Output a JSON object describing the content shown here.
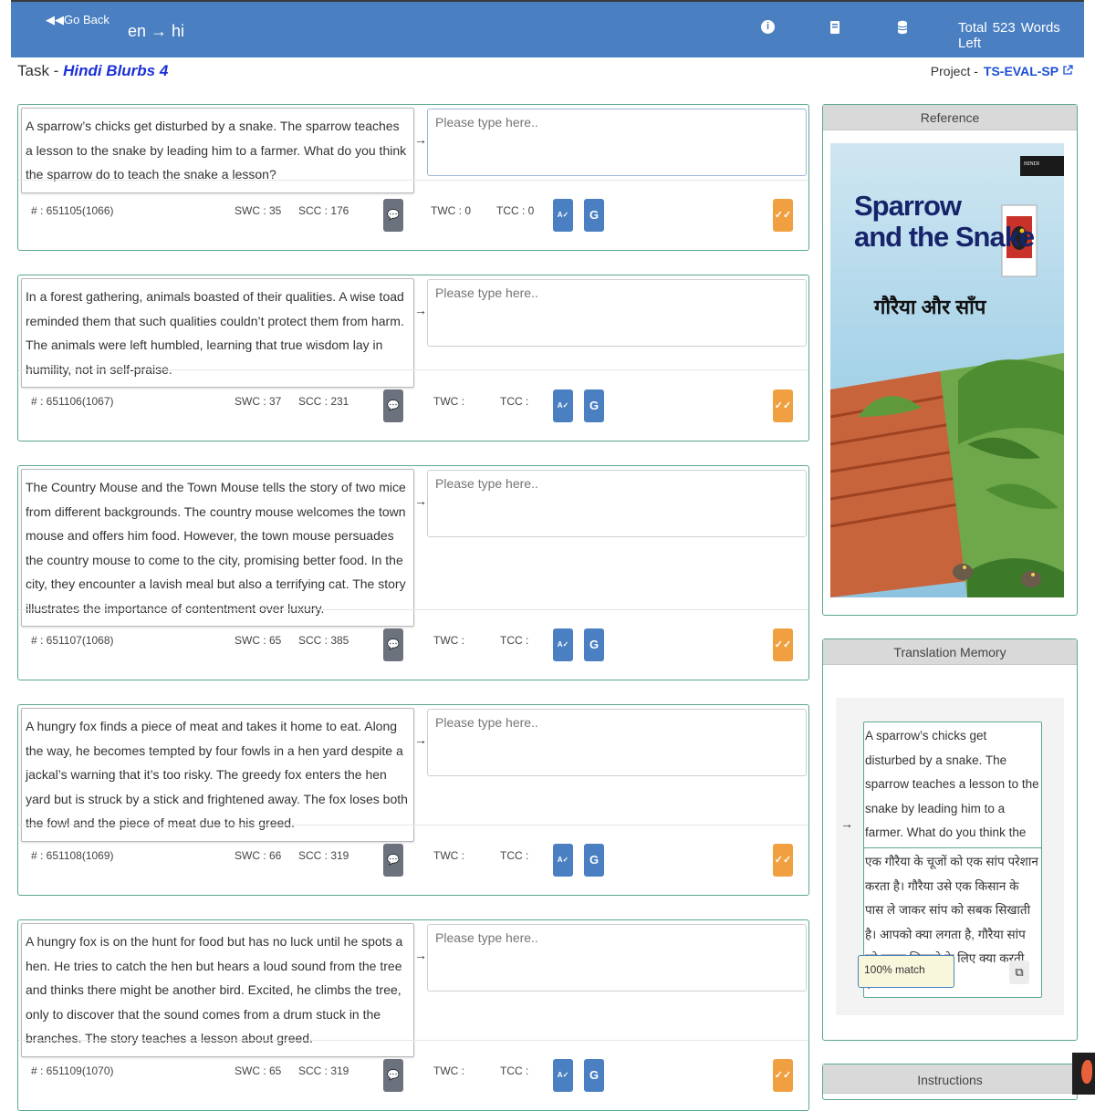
{
  "header": {
    "go_back": "◀◀Go Back",
    "lang_pair": "en → hi",
    "icons": [
      "info-icon",
      "book-icon",
      "database-icon"
    ],
    "words_total_label": "Total",
    "words_count": "523",
    "words_left_label": "Words Left"
  },
  "task": {
    "label": "Task -",
    "name": "Hindi Blurbs 4"
  },
  "project": {
    "label": "Project -",
    "name": "TS-EVAL-SP"
  },
  "target_placeholder": "Please type here..",
  "segments": [
    {
      "source": "A sparrow’s chicks get disturbed by a snake. The sparrow teaches a lesson to the snake by leading him to a farmer. What do you think the sparrow do to teach the snake a lesson?",
      "id": "# : 651105(1066)",
      "swc": "SWC : 35",
      "scc": "SCC : 176",
      "twc": "TWC : 0",
      "tcc": "TCC : 0"
    },
    {
      "source": "In a forest gathering, animals boasted of their qualities. A wise toad reminded them that such qualities couldn’t protect them from harm. The animals were left humbled, learning that true wisdom lay in humility, not in self-praise.",
      "id": "# : 651106(1067)",
      "swc": "SWC : 37",
      "scc": "SCC : 231",
      "twc": "TWC :",
      "tcc": "TCC :"
    },
    {
      "source": "The Country Mouse and the Town Mouse tells the story of two mice from different backgrounds. The country mouse welcomes the town mouse and offers him food. However, the town mouse persuades the country mouse to come to the city, promising better food. In the city, they encounter a lavish meal but also a terrifying cat. The story illustrates the importance of contentment over luxury.",
      "id": "# : 651107(1068)",
      "swc": "SWC : 65",
      "scc": "SCC : 385",
      "twc": "TWC :",
      "tcc": "TCC :"
    },
    {
      "source": "A hungry fox finds a piece of meat and takes it home to eat. Along the way, he becomes tempted by four fowls in a hen yard despite a jackal’s warning that it’s too risky. The greedy fox enters the hen yard but is struck by a stick and frightened away. The fox loses both the fowl and the piece of meat due to his greed.",
      "id": "# : 651108(1069)",
      "swc": "SWC : 66",
      "scc": "SCC : 319",
      "twc": "TWC :",
      "tcc": "TCC :"
    },
    {
      "source": "A hungry fox is on the hunt for food but has no luck until he spots a hen. He tries to catch the hen but hears a loud sound from the tree and thinks there might be another bird. Excited, he climbs the tree, only to discover that the sound comes from a drum stuck in the branches. The story teaches a lesson about greed.",
      "id": "# : 651109(1070)",
      "swc": "SWC : 65",
      "scc": "SCC : 319",
      "twc": "TWC :",
      "tcc": "TCC :"
    }
  ],
  "reference": {
    "title": "Reference",
    "book_tag": "HINDI",
    "book_title_line1": "Sparrow",
    "book_title_line2": "and the Snake",
    "book_title_hindi": "गौरैया और साँप"
  },
  "tm": {
    "title": "Translation Memory",
    "source": "A sparrow’s chicks get disturbed by a snake. The sparrow teaches a lesson to the snake by leading him to a farmer. What do you think the sparrow do to teach the snake a lesson?",
    "target": "एक गौरैया के चूजों को एक सांप परेशान करता है। गौरैया उसे एक किसान के पास ले जाकर सांप को सबक सिखाती है। आपको क्या लगता है, गौरैया सांप को सबक सिखाने के लिए क्या करती है?",
    "match": "100% match"
  },
  "instructions": {
    "title": "Instructions"
  },
  "colors": {
    "header": "#4a7fc1",
    "accent_green": "#5aa98a",
    "done_orange": "#f0a040"
  }
}
